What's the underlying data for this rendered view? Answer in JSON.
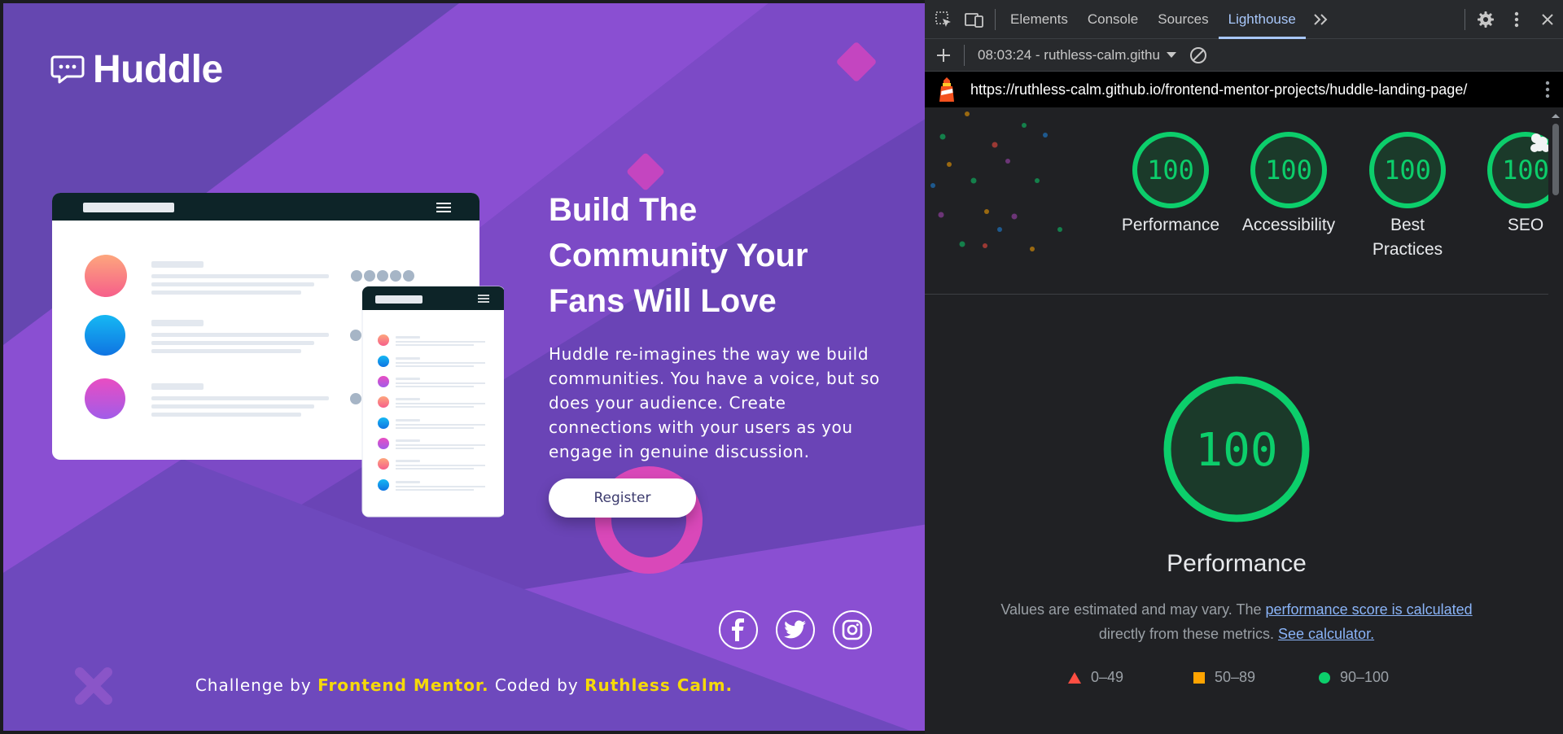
{
  "site": {
    "logo": "Huddle",
    "headline": "Build The Community Your Fans Will Love",
    "description": "Huddle re-imagines the way we build communities. You have a voice, but so does your audience. Create connections with your users as you engage in genuine discussion.",
    "register_label": "Register",
    "social_icons": [
      "facebook-icon",
      "twitter-icon",
      "instagram-icon"
    ],
    "footer": {
      "prefix": "Challenge by",
      "mentor": "Frontend Mentor.",
      "middle": "Coded by",
      "author": "Ruthless Calm."
    },
    "colors": {
      "background": "#6a44b6",
      "accent_yellow": "#f5d90a",
      "button_text": "#3c3b6e"
    }
  },
  "devtools": {
    "tabs": [
      "Elements",
      "Console",
      "Sources",
      "Lighthouse"
    ],
    "active_tab": "Lighthouse",
    "run_label": "08:03:24 - ruthless-calm.githu",
    "url": "https://ruthless-calm.github.io/frontend-mentor-projects/huddle-landing-page/",
    "scores": [
      {
        "label": "Performance",
        "value": "100"
      },
      {
        "label": "Accessibility",
        "value": "100"
      },
      {
        "label": "Best Practices",
        "value": "100"
      },
      {
        "label": "SEO",
        "value": "100"
      }
    ],
    "main_score": "100",
    "main_title": "Performance",
    "note": {
      "text1": "Values are estimated and may vary. The",
      "link1": "performance score is calculated",
      "text2": "directly from these metrics.",
      "link2": "See calculator."
    },
    "legend": [
      {
        "shape": "triangle",
        "color": "#ff4e42",
        "label": "0–49"
      },
      {
        "shape": "square",
        "color": "#ffa400",
        "label": "50–89"
      },
      {
        "shape": "circle",
        "color": "#0cce6b",
        "label": "90–100"
      }
    ],
    "colors": {
      "pass": "#0cce6b",
      "link": "#8ab4f8",
      "active_tab": "#a8c7fa"
    }
  }
}
